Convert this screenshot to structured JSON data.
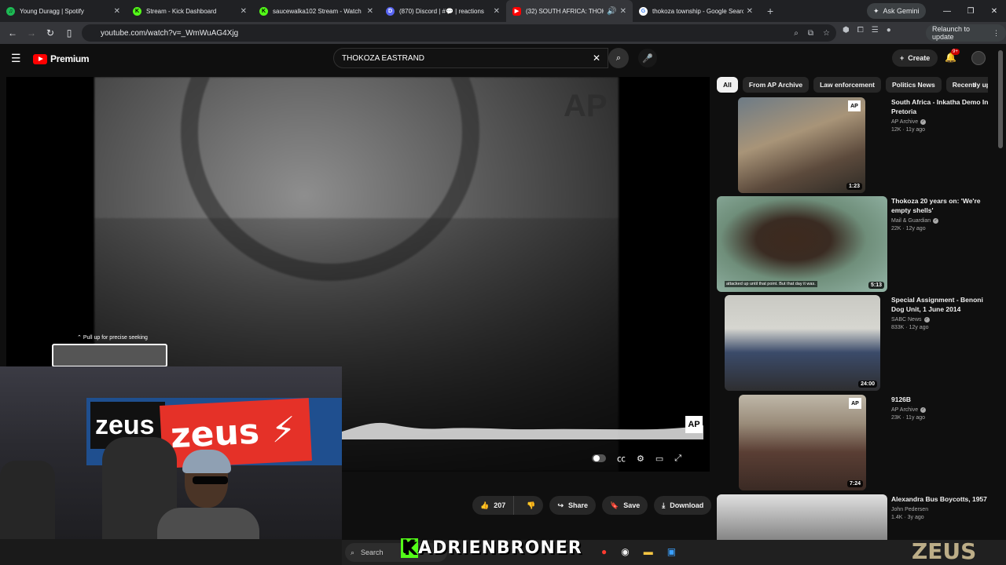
{
  "browser": {
    "tabs": [
      {
        "title": "Young Duragg | Spotify",
        "color": "#1db954",
        "glyph": "♫"
      },
      {
        "title": "Stream - Kick Dashboard",
        "color": "#53fc18",
        "glyph": "K"
      },
      {
        "title": "saucewalka102 Stream - Watch",
        "color": "#53fc18",
        "glyph": "K"
      },
      {
        "title": "(870) Discord | #💬 | reactions",
        "color": "#5865f2",
        "glyph": "D"
      },
      {
        "title": "(32) SOUTH AFRICA: THOKO",
        "color": "#ff0000",
        "glyph": "▶",
        "active": true
      },
      {
        "title": "thokoza township - Google Search",
        "color": "#ffffff",
        "glyph": "G"
      }
    ],
    "gemini_label": "Ask Gemini",
    "url": "youtube.com/watch?v=_WmWuAG4Xjg",
    "relaunch_label": "Relaunch to update"
  },
  "youtube": {
    "logo_text": "Premium",
    "search_value": "THOKOZA EASTRAND",
    "create_label": "Create",
    "notification_count": "9+"
  },
  "player": {
    "watermark": "AP",
    "seek_hint": "Pull up for precise seeking"
  },
  "actions": {
    "likes": "207",
    "share": "Share",
    "save": "Save",
    "download": "Download"
  },
  "chips": [
    "All",
    "From AP Archive",
    "Law enforcement",
    "Politics News",
    "Recently uploaded"
  ],
  "recommendations": [
    {
      "title": "South Africa - Inkatha Demo In Pretoria",
      "channel": "AP Archive",
      "stats": "12K · 11y ago",
      "duration": "1:23",
      "ap": true
    },
    {
      "title": "Thokoza 20 years on: 'We're empty shells'",
      "channel": "Mail & Guardian",
      "stats": "22K · 12y ago",
      "duration": "5:13",
      "caption": "attacked up until that point. But that day it was.",
      "ap": false
    },
    {
      "title": "Special Assignment - Benoni Dog Unit, 1 June 2014",
      "channel": "SABC News",
      "stats": "833K · 12y ago",
      "duration": "24:00",
      "ap": false
    },
    {
      "title": "9126B",
      "channel": "AP Archive",
      "stats": "23K · 11y ago",
      "duration": "7:24",
      "ap": true
    },
    {
      "title": "Alexandra Bus Boycotts, 1957",
      "channel": "John Pedersen",
      "stats": "1.4K · 3y ago",
      "duration": "",
      "ap": false
    }
  ],
  "taskbar": {
    "search_placeholder": "Search"
  },
  "overlay": {
    "streamer_name": "ADRIENBRONER",
    "kick_letter": "K",
    "brand_watermark": "ZEUS"
  }
}
